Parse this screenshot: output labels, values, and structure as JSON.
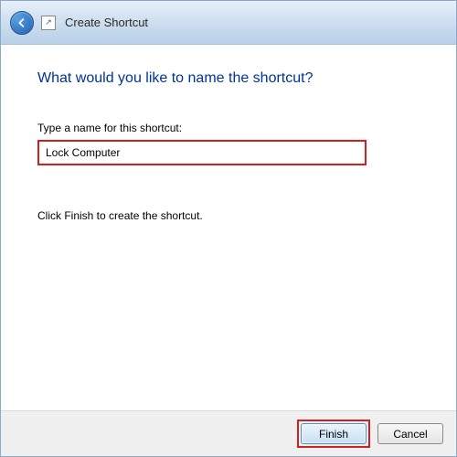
{
  "window": {
    "title": "Create Shortcut"
  },
  "content": {
    "heading": "What would you like to name the shortcut?",
    "field_label": "Type a name for this shortcut:",
    "input_value": "Lock Computer",
    "instruction": "Click Finish to create the shortcut."
  },
  "footer": {
    "finish_label": "Finish",
    "cancel_label": "Cancel"
  },
  "colors": {
    "highlight": "#d02020",
    "heading": "#003399"
  }
}
